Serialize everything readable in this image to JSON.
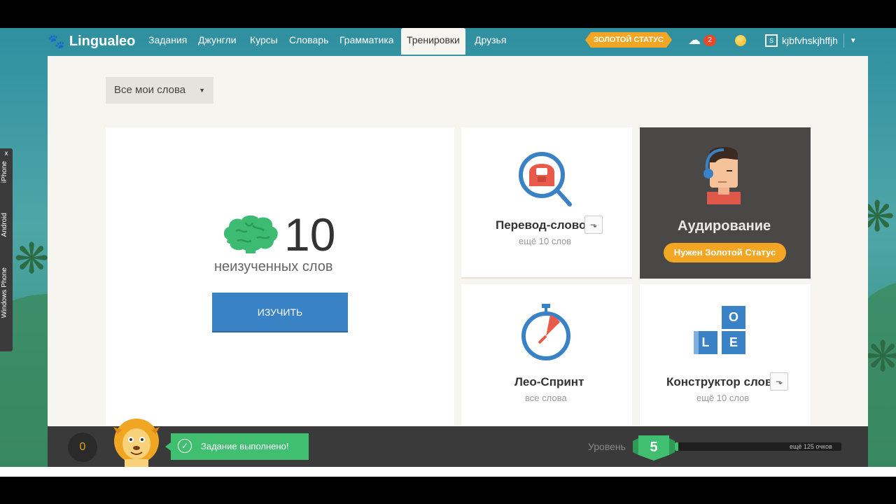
{
  "app": {
    "name": "Lingualeo"
  },
  "nav": {
    "items": [
      {
        "label": "Задания",
        "active": false
      },
      {
        "label": "Джунгли",
        "active": false
      },
      {
        "label": "Курсы",
        "active": false
      },
      {
        "label": "Словарь",
        "active": false
      },
      {
        "label": "Грамматика",
        "active": false
      },
      {
        "label": "Тренировки",
        "active": true
      },
      {
        "label": "Друзья",
        "active": false
      }
    ],
    "gold_status": "ЗОЛОТОЙ СТАТУС",
    "notifications_count": "2",
    "username": "kjbfvhskjhffjh"
  },
  "filter": {
    "label": "Все мои слова"
  },
  "main_card": {
    "count": "10",
    "label": "неизученных слов",
    "button": "ИЗУЧИТЬ"
  },
  "trainings": [
    {
      "title": "Перевод-слово",
      "subtitle": "ещё 10 слов"
    },
    {
      "title": "Аудирование",
      "badge": "Нужен Золотой Статус"
    },
    {
      "title": "Лео-Спринт",
      "subtitle": "все слова"
    },
    {
      "title": "Конструктор слов",
      "subtitle": "ещё 10 слов",
      "tiles": [
        "O",
        "L",
        "E"
      ]
    }
  ],
  "bottom": {
    "score": "0",
    "toast": "Задание выполнено!",
    "level_label": "Уровень",
    "level": "5",
    "progress_text": "ещё 125 очков",
    "progress_fraction": 0.02
  },
  "side_tabs": [
    "iPhone",
    "Android",
    "Windows Phone"
  ],
  "side_close": "x",
  "colors": {
    "accent": "#3a82c6",
    "gold": "#f3a624",
    "green": "#3fbf6f"
  }
}
